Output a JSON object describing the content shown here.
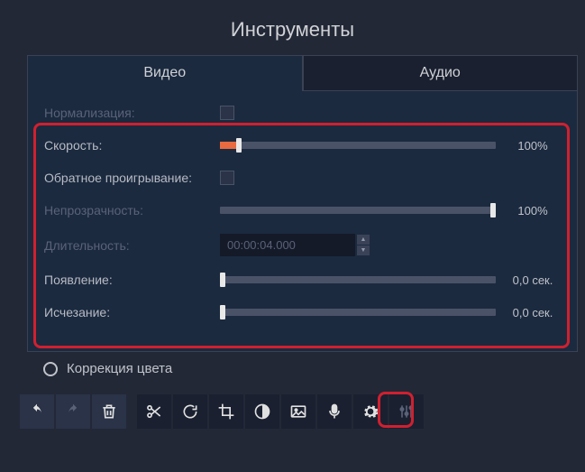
{
  "title": "Инструменты",
  "tabs": {
    "video": "Видео",
    "audio": "Аудио"
  },
  "rows": {
    "normalization_label": "Нормализация:",
    "speed_label": "Скорость:",
    "speed_value": "100%",
    "reverse_label": "Обратное проигрывание:",
    "opacity_label": "Непрозрачность:",
    "opacity_value": "100%",
    "duration_label": "Длительность:",
    "duration_value": "00:00:04.000",
    "fadein_label": "Появление:",
    "fadein_value": "0,0 сек.",
    "fadeout_label": "Исчезание:",
    "fadeout_value": "0,0 сек."
  },
  "color_correction": "Коррекция цвета"
}
